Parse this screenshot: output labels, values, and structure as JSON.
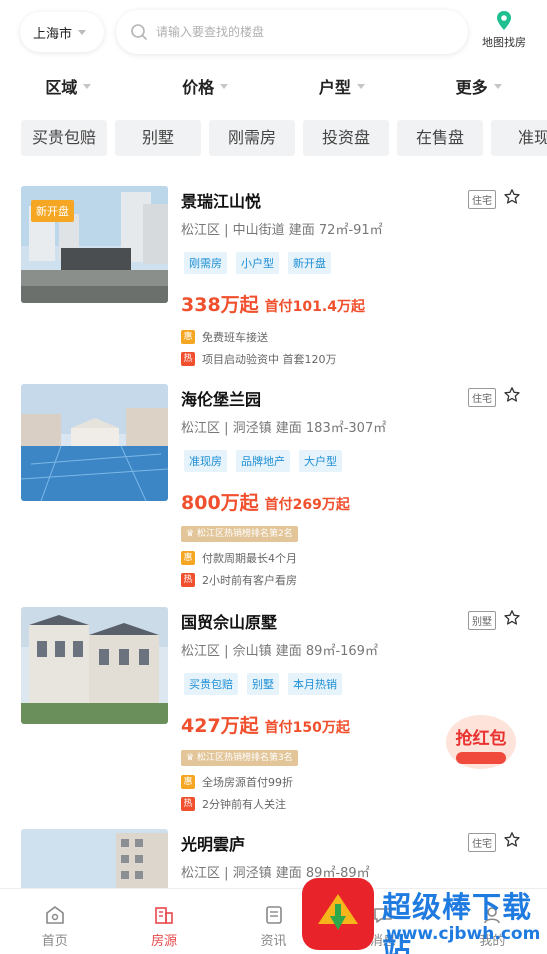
{
  "header": {
    "city": "上海市",
    "search_placeholder": "请输入要查找的楼盘",
    "map_label": "地图找房"
  },
  "filters": [
    "区域",
    "价格",
    "户型",
    "更多"
  ],
  "chips": [
    "买贵包赔",
    "别墅",
    "刚需房",
    "投资盘",
    "在售盘",
    "准现"
  ],
  "listings": [
    {
      "badge": "新开盘",
      "name": "景瑞江山悦",
      "type": "住宅",
      "location": "松江区 | 中山街道 建面 72㎡-91㎡",
      "tags": [
        "刚需房",
        "小户型",
        "新开盘"
      ],
      "price": "338万起",
      "down_payment": "首付101.4万起",
      "rank": "",
      "info": [
        {
          "icon": "惠",
          "text": "免费班车接送"
        },
        {
          "icon": "热",
          "text": "项目启动验资中 首套120万"
        }
      ]
    },
    {
      "badge": "",
      "name": "海伦堡兰园",
      "type": "住宅",
      "location": "松江区 | 洞泾镇 建面 183㎡-307㎡",
      "tags": [
        "准现房",
        "品牌地产",
        "大户型"
      ],
      "price": "800万起",
      "down_payment": "首付269万起",
      "rank": "松江区热销榜排名第2名",
      "info": [
        {
          "icon": "惠",
          "text": "付款周期最长4个月"
        },
        {
          "icon": "热",
          "text": "2小时前有客户看房"
        }
      ]
    },
    {
      "badge": "",
      "name": "国贸佘山原墅",
      "type": "别墅",
      "location": "松江区 | 佘山镇 建面 89㎡-169㎡",
      "tags": [
        "买贵包赔",
        "别墅",
        "本月热销"
      ],
      "price": "427万起",
      "down_payment": "首付150万起",
      "rank": "松江区热销榜排名第3名",
      "info": [
        {
          "icon": "惠",
          "text": "全场房源首付99折"
        },
        {
          "icon": "热",
          "text": "2分钟前有人关注"
        }
      ]
    },
    {
      "badge": "",
      "name": "光明雲庐",
      "type": "住宅",
      "location": "松江区 | 洞泾镇 建面 89㎡-89㎡",
      "tags": [],
      "price": "",
      "down_payment": "",
      "rank": "",
      "info": []
    }
  ],
  "promo_text": "抢红包",
  "bottom_nav": [
    {
      "label": "首页",
      "icon": "home-icon",
      "active": false
    },
    {
      "label": "房源",
      "icon": "building-icon",
      "active": true
    },
    {
      "label": "资讯",
      "icon": "news-icon",
      "active": false
    },
    {
      "label": "消息",
      "icon": "message-icon",
      "active": false
    },
    {
      "label": "我的",
      "icon": "user-icon",
      "active": false
    }
  ],
  "watermark": {
    "title": "超级棒下载站",
    "url": "www.cjbwh.com"
  },
  "colors": {
    "accent": "#e8484b",
    "price": "#f0502d",
    "tag_text": "#1e8fd5",
    "tag_bg": "#e6f3fb",
    "map_icon": "#1fbf8f"
  }
}
